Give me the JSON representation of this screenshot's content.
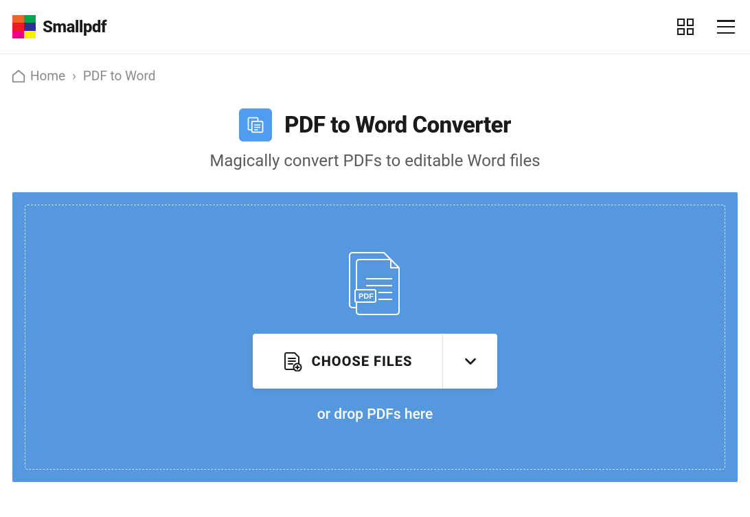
{
  "header": {
    "brand": "Smallpdf"
  },
  "breadcrumb": {
    "home": "Home",
    "separator": "›",
    "current": "PDF to Word"
  },
  "tool": {
    "title": "PDF to Word Converter",
    "subtitle": "Magically convert PDFs to editable Word files"
  },
  "upload": {
    "button": "CHOOSE FILES",
    "hint": "or drop PDFs here"
  }
}
